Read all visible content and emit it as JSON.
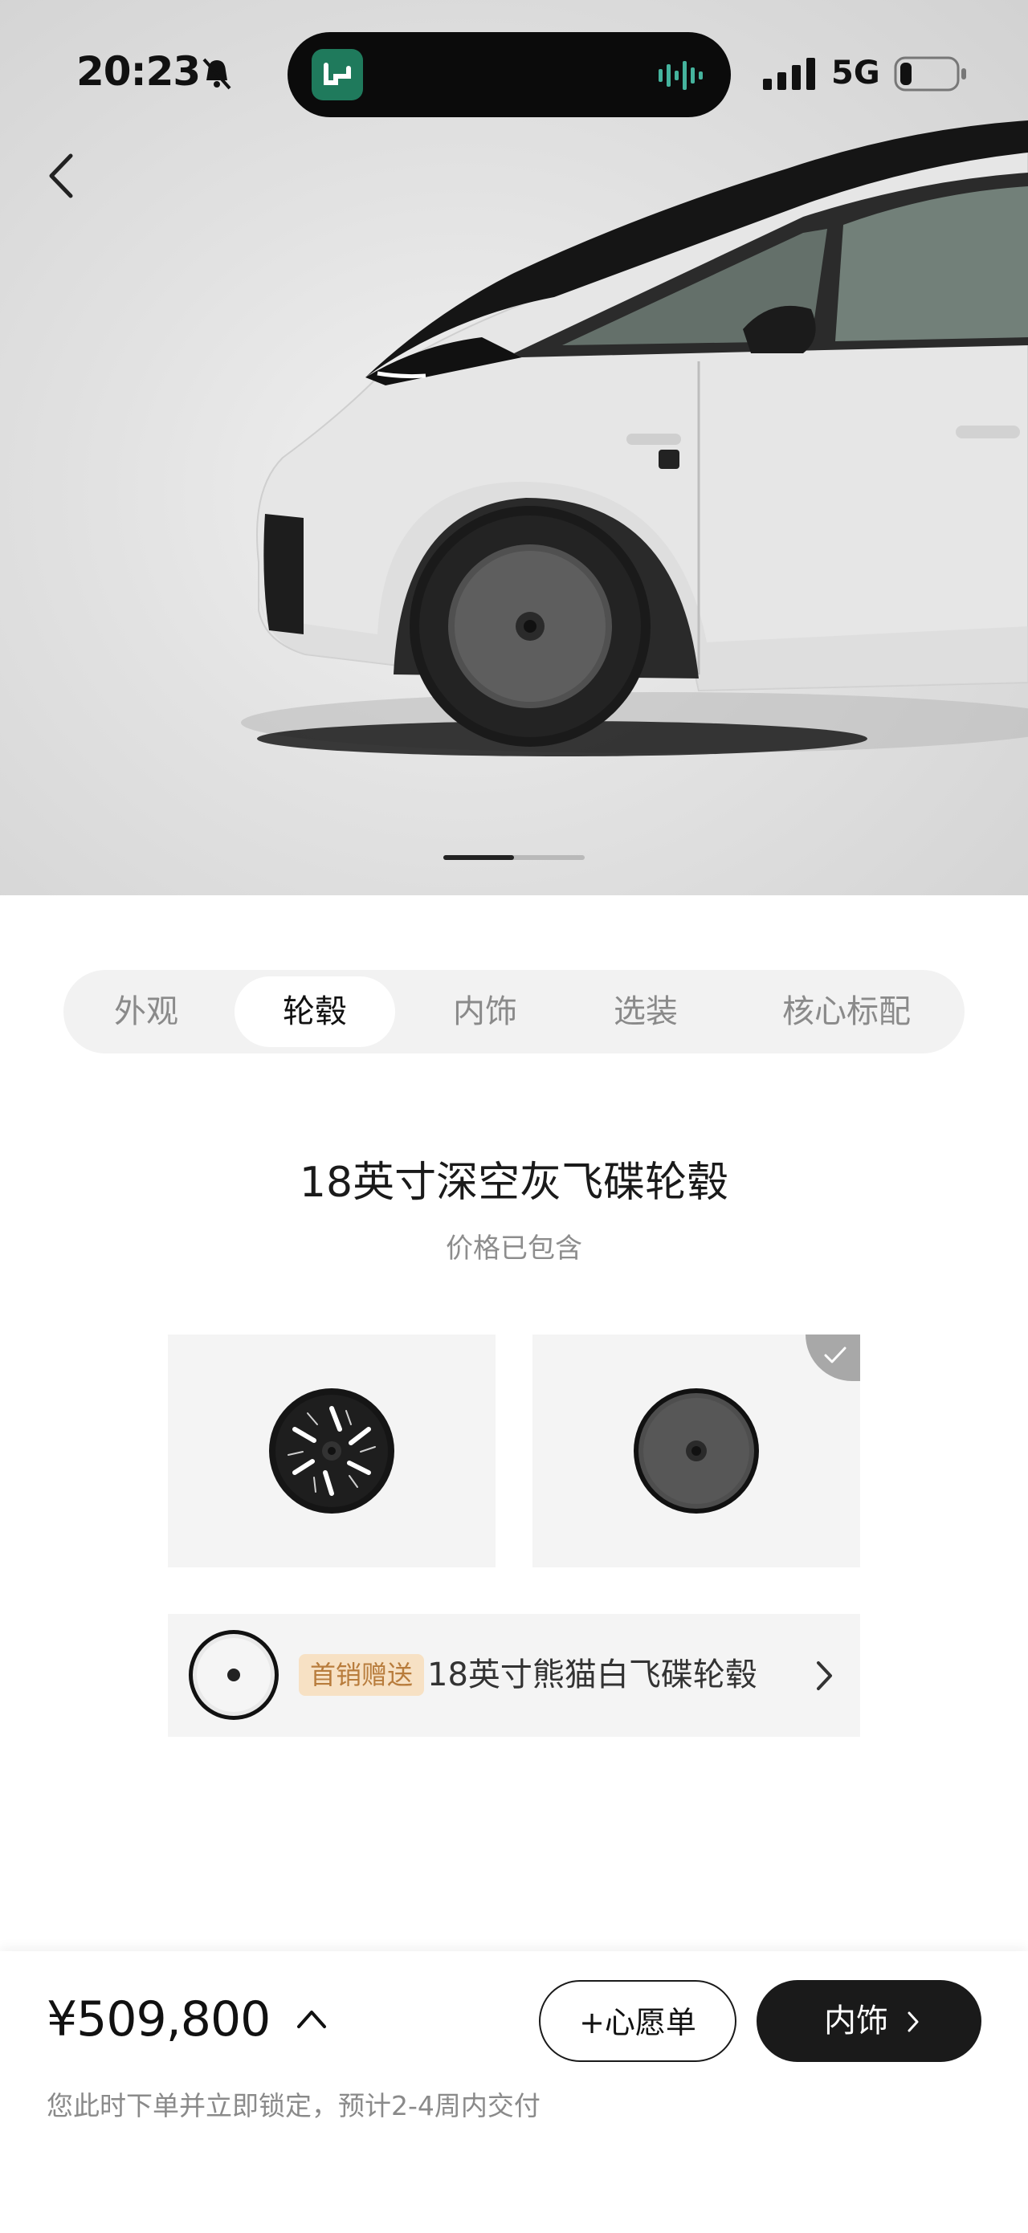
{
  "status_bar": {
    "time": "20:23",
    "network": "5G",
    "icons": [
      "bell-off-icon",
      "app-icon",
      "waveform-icon",
      "signal-icon",
      "battery-icon"
    ]
  },
  "gallery": {
    "current_page": 1,
    "total_pages": 2
  },
  "tabs": {
    "items": [
      "外观",
      "轮毂",
      "内饰",
      "选装",
      "核心标配"
    ],
    "active": "轮毂"
  },
  "wheel": {
    "title": "18英寸深空灰飞碟轮毂",
    "subtitle": "价格已包含",
    "options": [
      {
        "style": "black-white-spoke",
        "selected": false
      },
      {
        "style": "deep-space-grey-disc",
        "selected": true
      }
    ]
  },
  "promo": {
    "badge": "首销赠送",
    "name": "18英寸熊猫白飞碟轮毂"
  },
  "footer": {
    "price": "¥509,800",
    "wishlist_label": "+心愿单",
    "next_label": "内饰",
    "delivery_note": "您此时下单并立即锁定，预计2-4周内交付"
  },
  "colors": {
    "primary": "#1a1a1a",
    "badge_bg": "#f7e1c4",
    "badge_text": "#b87c3c",
    "muted_text": "#8a8a8a"
  }
}
